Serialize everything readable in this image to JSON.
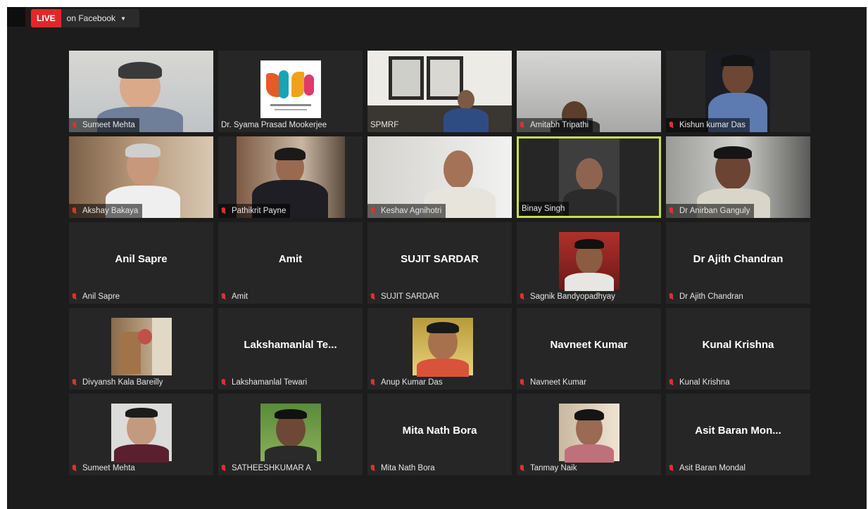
{
  "live": {
    "badge": "LIVE",
    "label": "on Facebook"
  },
  "tiles": [
    {
      "label": "Sumeet Mehta"
    },
    {
      "label": "Dr. Syama Prasad Mookerjee"
    },
    {
      "label": "SPMRF"
    },
    {
      "label": "Amitabh Tripathi"
    },
    {
      "label": "Kishun kumar Das"
    },
    {
      "label": "Akshay Bakaya"
    },
    {
      "label": "Pathikrit Payne"
    },
    {
      "label": "Keshav Agnihotri"
    },
    {
      "label": "Binay Singh"
    },
    {
      "label": "Dr Anirban Ganguly"
    },
    {
      "label": "Anil Sapre",
      "big": "Anil Sapre"
    },
    {
      "label": "Amit",
      "big": "Amit"
    },
    {
      "label": "SUJIT SARDAR",
      "big": "SUJIT SARDAR"
    },
    {
      "label": "Sagnik Bandyopadhyay"
    },
    {
      "label": "Dr Ajith Chandran",
      "big": "Dr Ajith Chandran"
    },
    {
      "label": "Divyansh Kala Bareilly"
    },
    {
      "label": "Lakshamanlal Tewari",
      "big": "Lakshamanlal  Te..."
    },
    {
      "label": "Anup Kumar Das"
    },
    {
      "label": "Navneet Kumar",
      "big": "Navneet Kumar"
    },
    {
      "label": "Kunal Krishna",
      "big": "Kunal Krishna"
    },
    {
      "label": "Sumeet Mehta"
    },
    {
      "label": "SATHEESHKUMAR A"
    },
    {
      "label": "Mita Nath Bora",
      "big": "Mita Nath Bora"
    },
    {
      "label": "Tanmay Naik"
    },
    {
      "label": "Asit Baran Mondal",
      "big": "Asit  Baran  Mon..."
    }
  ],
  "colors": {
    "live": "#e02828",
    "active_speaker": "#c6e04a",
    "background": "#1c1c1c",
    "tile": "#262626"
  }
}
